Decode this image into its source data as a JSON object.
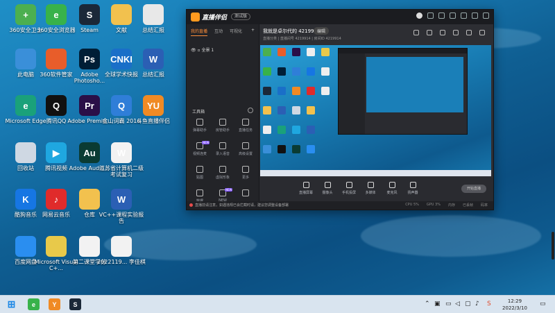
{
  "desktop_icons": [
    {
      "label": "360安全卫士",
      "color": "#4caf50",
      "glyph": "+"
    },
    {
      "label": "360安全浏览器",
      "color": "#38b24a",
      "glyph": "e"
    },
    {
      "label": "Steam",
      "color": "#1b2838",
      "glyph": "S"
    },
    {
      "label": "文献",
      "color": "#f2c14e",
      "glyph": ""
    },
    {
      "label": "总结汇报",
      "color": "#e8e8e8",
      "glyph": ""
    },
    {
      "label": "此电脑",
      "color": "#3a8fd9",
      "glyph": ""
    },
    {
      "label": "360软件管家",
      "color": "#e85d2a",
      "glyph": ""
    },
    {
      "label": "Adobe Photosho...",
      "color": "#001e36",
      "glyph": "Ps"
    },
    {
      "label": "全球学术快报",
      "color": "#1a6fc8",
      "glyph": "CNKI"
    },
    {
      "label": "总结汇报",
      "color": "#2b5fb4",
      "glyph": "W"
    },
    {
      "label": "Microsoft Edge",
      "color": "#1aa17a",
      "glyph": "e"
    },
    {
      "label": "腾讯QQ",
      "color": "#111111",
      "glyph": "Q"
    },
    {
      "label": "Adobe Premie...",
      "color": "#2a0f48",
      "glyph": "Pr"
    },
    {
      "label": "金山词霸 2016",
      "color": "#2f7ed8",
      "glyph": "Q"
    },
    {
      "label": "斗鱼直播伴侣",
      "color": "#f08a24",
      "glyph": "YU"
    },
    {
      "label": "回收站",
      "color": "#cfd8e3",
      "glyph": ""
    },
    {
      "label": "腾讯视频",
      "color": "#1fa7e0",
      "glyph": "▶"
    },
    {
      "label": "Adobe Auditi...",
      "color": "#0a3b33",
      "glyph": "Au"
    },
    {
      "label": "江苏省计算机二级考试复习",
      "color": "#f2f2f2",
      "glyph": "W"
    },
    {
      "label": "酷狗音乐",
      "color": "#1676e3",
      "glyph": "K"
    },
    {
      "label": "网易云音乐",
      "color": "#e02b2b",
      "glyph": "♪"
    },
    {
      "label": "仓库",
      "color": "#f2c14e",
      "glyph": ""
    },
    {
      "label": "VC++课程实验报告",
      "color": "#2b5fb4",
      "glyph": "W"
    },
    {
      "label": "百度网盘",
      "color": "#2a8ef0",
      "glyph": ""
    },
    {
      "label": "Microsoft Visual C+...",
      "color": "#e8c94a",
      "glyph": ""
    },
    {
      "label": "第二课堂学分",
      "color": "#f2f2f2",
      "glyph": ""
    },
    {
      "label": "2022119... 李佳棋",
      "color": "#f2f2f2",
      "glyph": ""
    }
  ],
  "app": {
    "name": "直播伴侣",
    "beta": "测试版",
    "tabs": [
      "我的直播",
      "互动",
      "可视化"
    ],
    "plus": "+",
    "scene": "全景 1",
    "tools_header": "工具箱",
    "tools": [
      {
        "label": "弹幕助手",
        "badge": ""
      },
      {
        "label": "房管助手",
        "badge": ""
      },
      {
        "label": "直播任务",
        "badge": ""
      },
      {
        "label": "视频连麦",
        "badge": "NEW"
      },
      {
        "label": "录入语音",
        "badge": ""
      },
      {
        "label": "高级设置",
        "badge": ""
      },
      {
        "label": "贴图",
        "badge": ""
      },
      {
        "label": "虚拟形象",
        "badge": ""
      },
      {
        "label": "更多",
        "badge": ""
      },
      {
        "label": "数据",
        "badge": ""
      },
      {
        "label": "NEW",
        "badge": "NEW"
      },
      {
        "label": "",
        "badge": ""
      }
    ],
    "room_title": "我就是卓尔代的 4219914",
    "room_pill": "编辑",
    "room_sub": "直播分类  |  直播间号 4219914  |  房间ID 4219914",
    "bottom_actions": [
      "直播屏幕",
      "摄像头",
      "手机投屏",
      "多媒体",
      "麦克风",
      "扬声器"
    ],
    "start_label": "开始直播",
    "status_msg": "直播前请注意，如遇违规已会拦截时请，建议您调整设备部署",
    "status_metrics": [
      "CPU 5%",
      "GPU 3%",
      "内存",
      "已丢帧",
      "码率"
    ]
  },
  "taskbar": {
    "apps": [
      {
        "name": "windows-icon",
        "color": "#1e88e5",
        "glyph": "⊞"
      },
      {
        "name": "edge-icon",
        "color": "#38b24a",
        "glyph": "e"
      },
      {
        "name": "douyu-icon",
        "color": "#f08a24",
        "glyph": "Y"
      },
      {
        "name": "steam-icon",
        "color": "#1b2838",
        "glyph": "S"
      }
    ],
    "time": "12:29",
    "date": "2022/3/10"
  }
}
